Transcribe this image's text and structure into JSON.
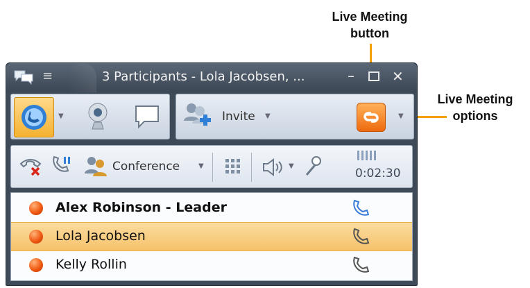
{
  "callouts": {
    "live_meeting_button": [
      "Live Meeting",
      "button"
    ],
    "live_meeting_options": [
      "Live Meeting",
      "options"
    ]
  },
  "window": {
    "title": "3 Participants - Lola Jacobsen, ..."
  },
  "toolbar": {
    "invite_label": "Invite"
  },
  "call_controls": {
    "conference_label": "Conference",
    "duration": "0:02:30"
  },
  "participants": [
    {
      "name": "Alex Robinson - Leader",
      "bold": true,
      "phone_color": "#3b7dd8"
    },
    {
      "name": "Lola Jacobsen",
      "bold": false,
      "phone_color": "#555555"
    },
    {
      "name": "Kelly Rollin",
      "bold": false,
      "phone_color": "#555555"
    }
  ],
  "colors": {
    "highlight_row": "#f6c26a",
    "callout_line": "#f2a100",
    "live_meeting_button": "#f07a1a"
  },
  "icons": {
    "title_left": "chat-bubbles-icon",
    "menu": "menu-icon",
    "minimize": "minimize-icon",
    "maximize": "maximize-icon",
    "close": "close-icon",
    "call": "call-icon",
    "video": "webcam-icon",
    "im": "chat-icon",
    "invite": "invite-people-icon",
    "live_meeting": "live-meeting-icon",
    "end_call": "end-call-icon",
    "hold": "hold-icon",
    "conference": "conference-icon",
    "dialpad": "dialpad-icon",
    "speaker": "speaker-icon",
    "mic": "microphone-icon",
    "signal": "signal-bars-icon",
    "phone": "phone-icon"
  }
}
